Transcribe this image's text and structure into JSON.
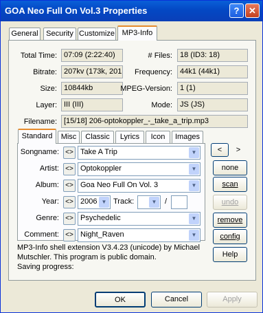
{
  "window": {
    "title": "GOA Neo Full On Vol.3 Properties",
    "help_glyph": "?",
    "close_glyph": "✕"
  },
  "tabs": [
    "General",
    "Security",
    "Customize",
    "MP3-Info"
  ],
  "info": {
    "total_time_label": "Total Time:",
    "total_time": "07:09 (2:22:40)",
    "files_label": "# Files:",
    "files": "18 (ID3: 18)",
    "bitrate_label": "Bitrate:",
    "bitrate": "207kv (173k, 201",
    "frequency_label": "Frequency:",
    "frequency": "44k1 (44k1)",
    "size_label": "Size:",
    "size": "10844kb",
    "mpeg_label": "MPEG-Version:",
    "mpeg": "1 (1)",
    "layer_label": "Layer:",
    "layer": "III (III)",
    "mode_label": "Mode:",
    "mode": "JS (JS)",
    "filename_label": "Filename:",
    "filename": "[15/18]  206-optokoppler_-_take_a_trip.mp3"
  },
  "inner_tabs": [
    "Standard",
    "Misc",
    "Classic",
    "Lyrics",
    "Icon",
    "Images"
  ],
  "fields": {
    "copy_glyph": "<>",
    "songname_label": "Songname:",
    "songname": "Take A Trip",
    "artist_label": "Artist:",
    "artist": "Optokoppler",
    "album_label": "Album:",
    "album": "Goa Neo Full On Vol. 3",
    "year_label": "Year:",
    "year": "2006",
    "track_label": "Track:",
    "track": "",
    "track_sep": "/",
    "track_total": "",
    "genre_label": "Genre:",
    "genre": "Psychedelic",
    "comment_label": "Comment:",
    "comment": "Night_Raven"
  },
  "side_buttons": {
    "prev": "<",
    "next": ">",
    "none": "none",
    "scan": "scan",
    "undo": "undo",
    "remove": "remove",
    "config": "config",
    "help": "Help"
  },
  "footer_text": {
    "line1": "MP3-Info shell extension V3.4.23 (unicode) by Michael",
    "line2": "Mutschler. This program is public domain.",
    "line3": "Saving progress:"
  },
  "dialog_buttons": {
    "ok": "OK",
    "cancel": "Cancel",
    "apply": "Apply"
  }
}
